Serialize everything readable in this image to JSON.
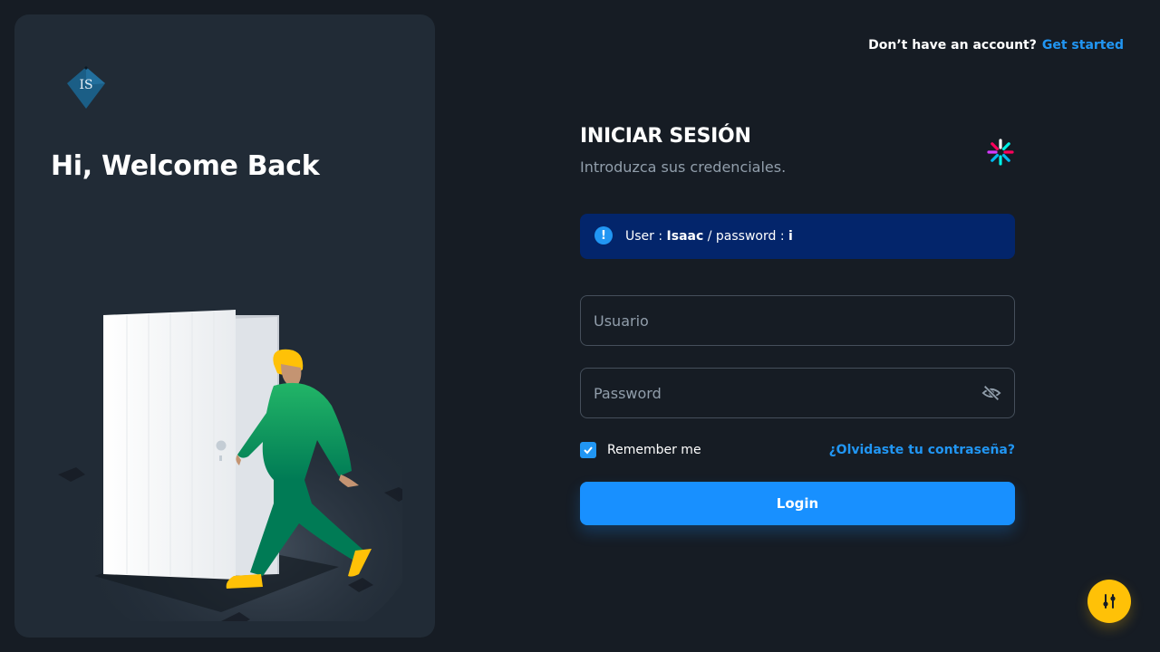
{
  "left_panel": {
    "logo_text": "IS",
    "welcome_title": "Hi, Welcome Back"
  },
  "header": {
    "signup_prompt": "Don’t have an account?",
    "signup_link": "Get started"
  },
  "form": {
    "title": "INICIAR SESIÓN",
    "subtitle": "Introduzca sus credenciales.",
    "alert": {
      "prefix": "User :",
      "user": "Isaac",
      "middle": "/ password :",
      "password": "i"
    },
    "username_placeholder": "Usuario",
    "password_placeholder": "Password",
    "remember_label": "Remember me",
    "forgot_link": "¿Olvidaste tu contraseña?",
    "login_label": "Login"
  },
  "icons": {
    "alert": "info-icon",
    "password_toggle": "eye-off-icon",
    "fab": "settings-sliders-icon"
  },
  "colors": {
    "background": "#161c24",
    "card": "#212b36",
    "accent": "#1890ff",
    "alert_bg": "#03256b",
    "fab": "#ffc107"
  }
}
